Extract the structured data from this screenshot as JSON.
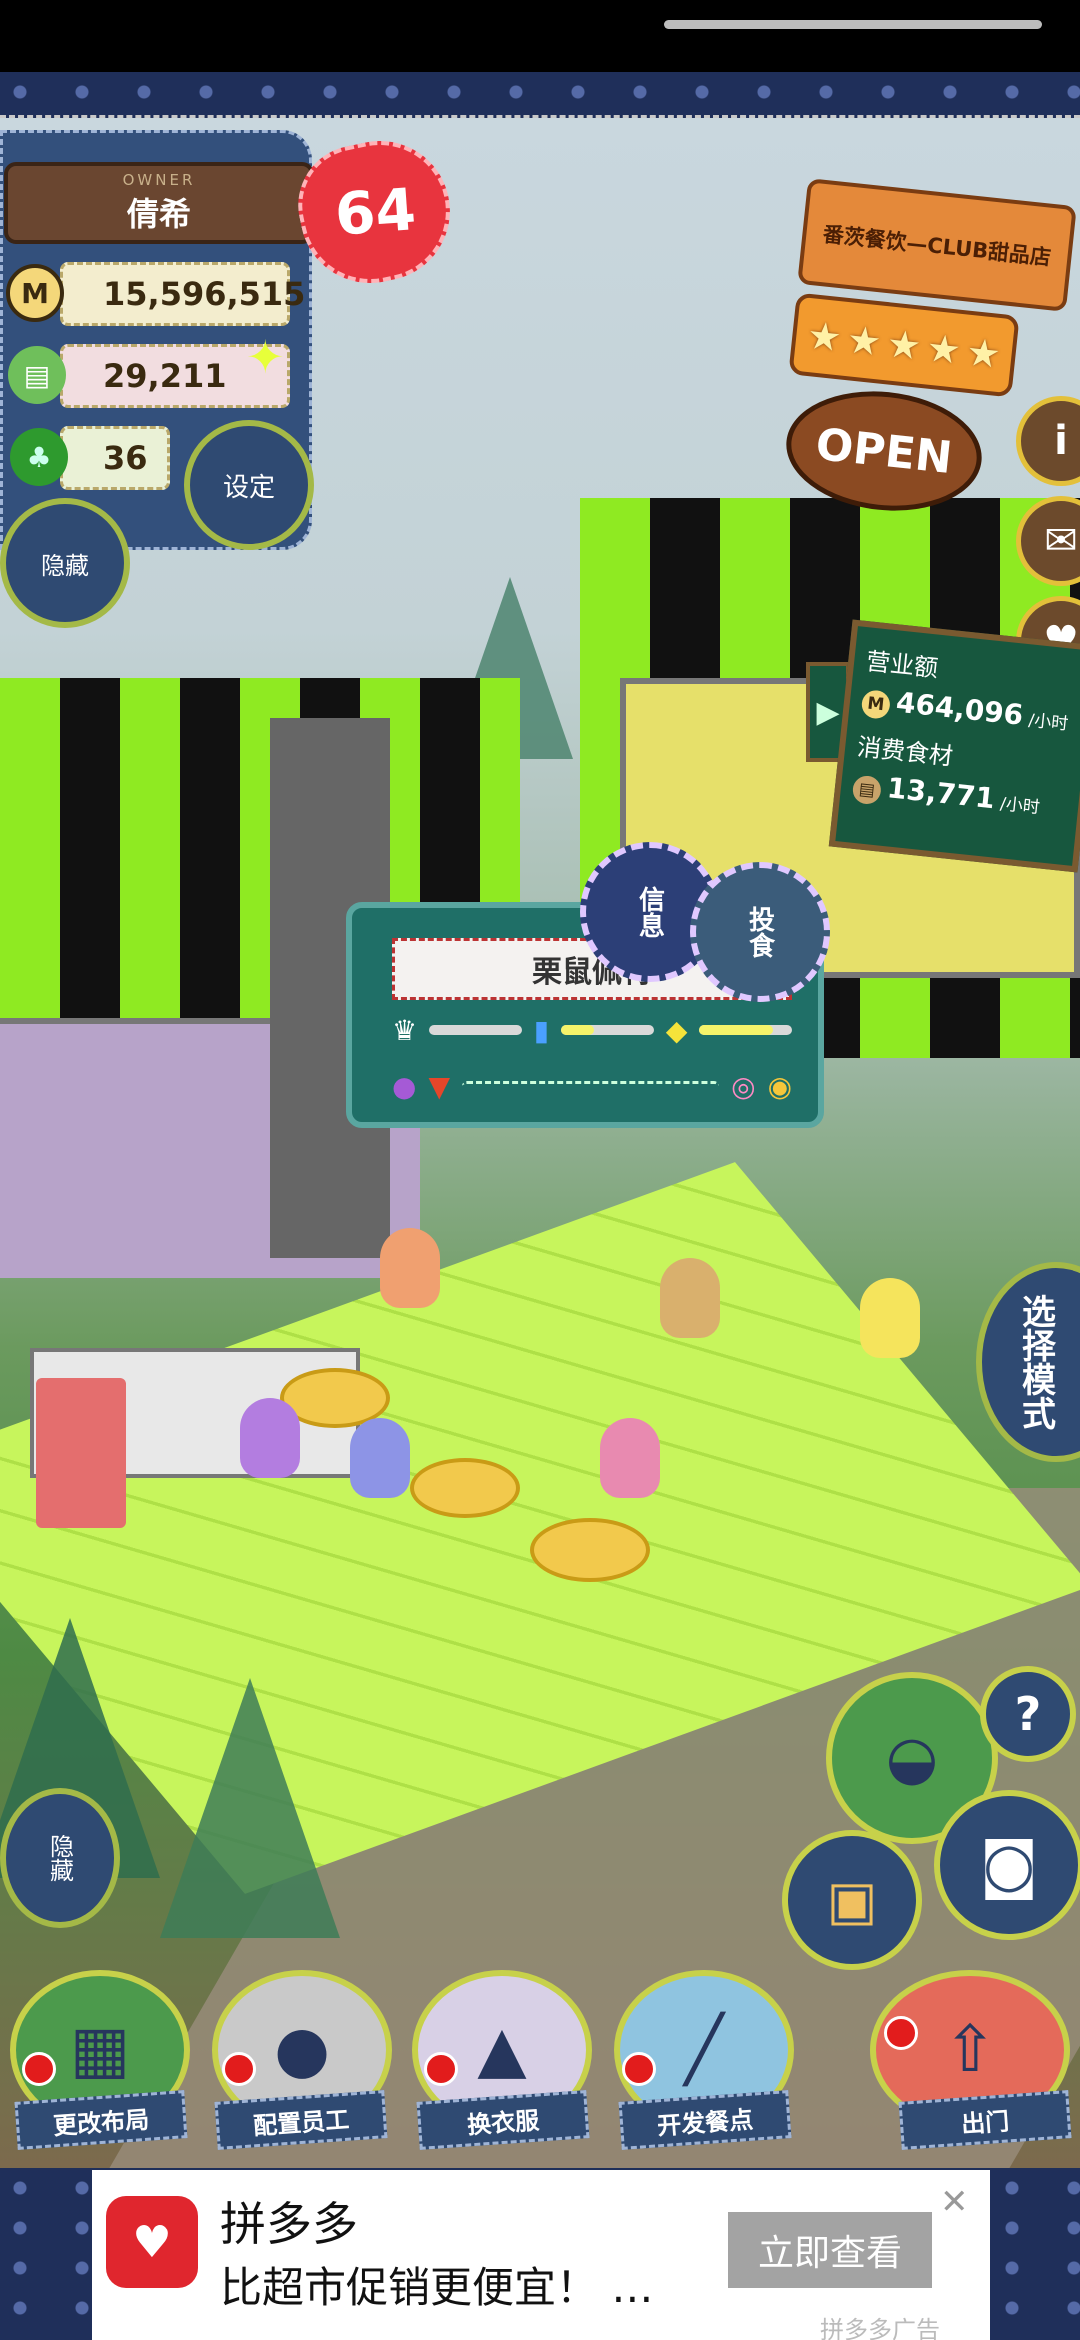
{
  "player": {
    "owner_tag": "OWNER",
    "name": "倩希",
    "level": "64",
    "coins": "15,596,515",
    "coin_icon": "M",
    "ingredients": "29,211",
    "clovers": "36"
  },
  "controls": {
    "settings_label": "设定",
    "hide_top_label": "隐藏",
    "hide_bottom_label": "隐藏",
    "mode_label": "选择模式"
  },
  "shop": {
    "name": "番茨餐饮—CLUB甜品店",
    "stars": 5,
    "status": "OPEN",
    "info_icon": "i"
  },
  "revenue": {
    "sales_label": "营业额",
    "sales_value": "464,096",
    "sales_unit": "/小时",
    "food_label": "消费食材",
    "food_value": "13,771",
    "food_unit": "/小时"
  },
  "customer_popup": {
    "name": "栗鼠佩特",
    "badge_left": "信息",
    "badge_right": "投食",
    "preferences": [
      {
        "icon": "chef-hat-icon",
        "glyph": "♛",
        "level": 0.0
      },
      {
        "icon": "drink-icon",
        "glyph": "▮",
        "level": 0.35
      },
      {
        "icon": "lemon-icon",
        "glyph": "◆",
        "level": 0.8
      }
    ]
  },
  "bottom_menu": [
    {
      "label": "更改布局",
      "glyph": "▦"
    },
    {
      "label": "配置员工",
      "glyph": "●"
    },
    {
      "label": "换衣服",
      "glyph": "▲"
    },
    {
      "label": "开发餐点",
      "glyph": "╱"
    },
    {
      "label": "出门",
      "glyph": "⇧"
    }
  ],
  "help_glyph": "?",
  "ad": {
    "title": "拼多多",
    "description": "比超市促销更便宜！ …",
    "cta": "立即查看",
    "close": "✕",
    "source": "拼多多广告"
  },
  "colors": {
    "denim": "#2f4a72",
    "lime": "#8fea22",
    "accent_red": "#e8343e",
    "board_green": "#17573e"
  }
}
